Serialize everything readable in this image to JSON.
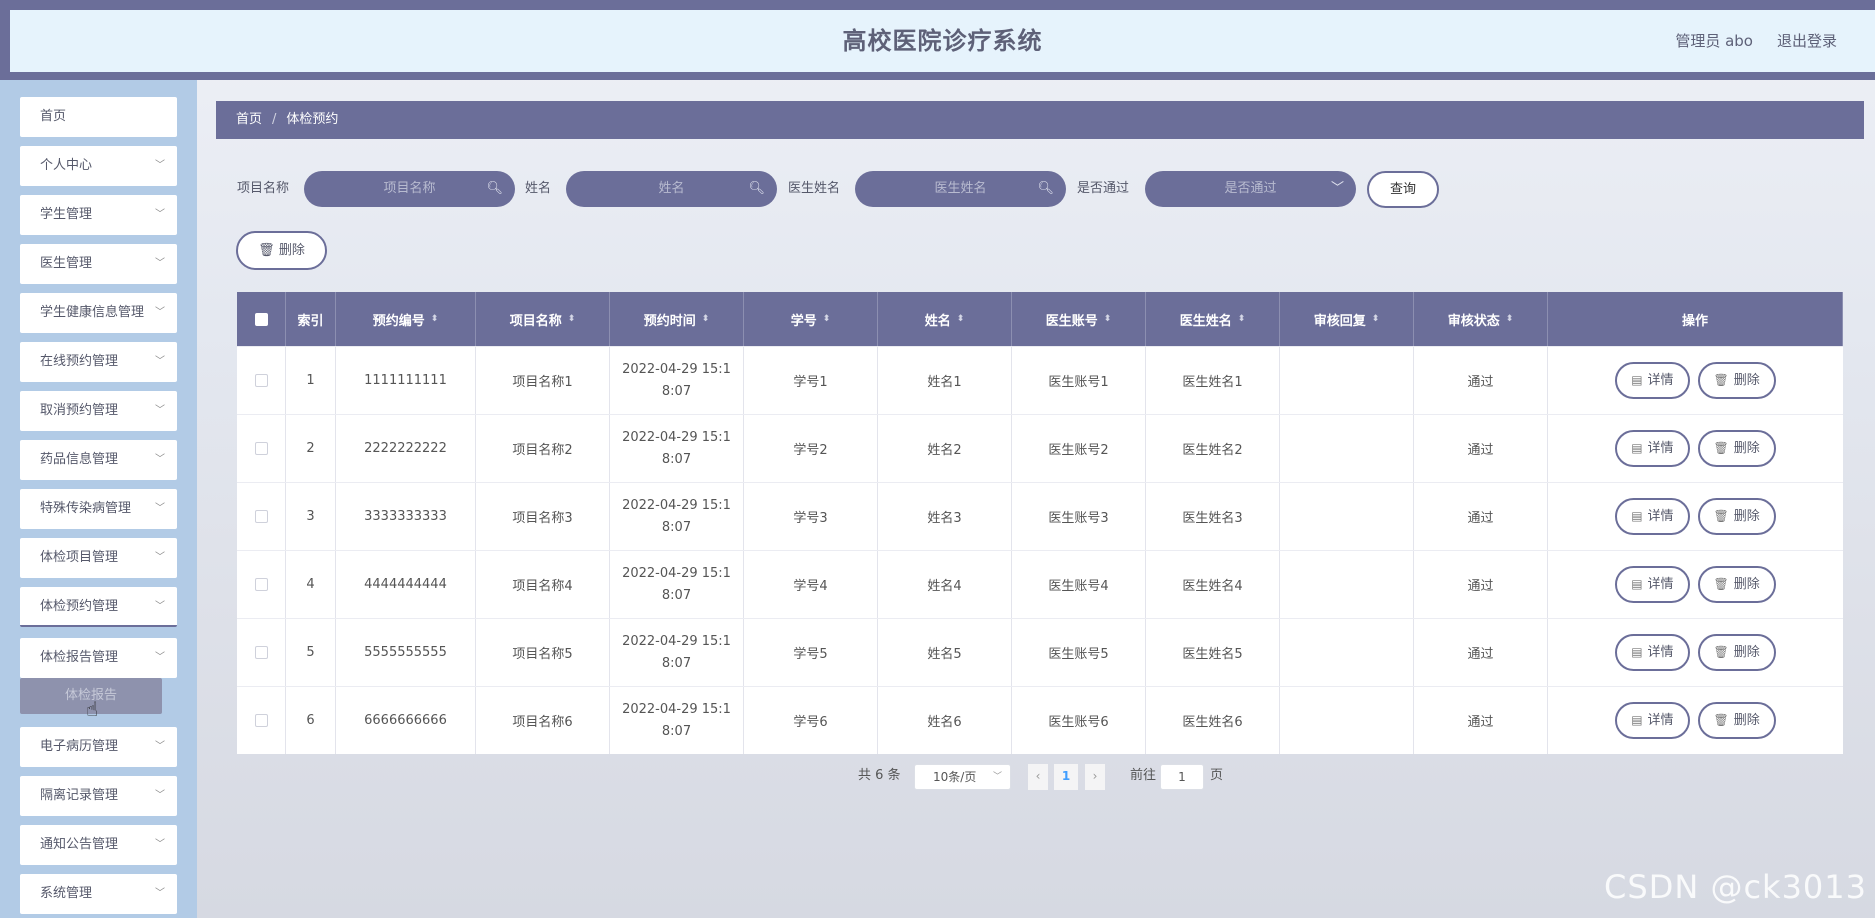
{
  "header": {
    "title": "高校医院诊疗系统",
    "admin": "管理员 abo",
    "logout": "退出登录"
  },
  "sidebar": {
    "items": [
      {
        "label": "首页",
        "chevron": false
      },
      {
        "label": "个人中心",
        "chevron": true
      },
      {
        "label": "学生管理",
        "chevron": true
      },
      {
        "label": "医生管理",
        "chevron": true
      },
      {
        "label": "学生健康信息管理",
        "chevron": true
      },
      {
        "label": "在线预约管理",
        "chevron": true
      },
      {
        "label": "取消预约管理",
        "chevron": true
      },
      {
        "label": "药品信息管理",
        "chevron": true
      },
      {
        "label": "特殊传染病管理",
        "chevron": true
      },
      {
        "label": "体检项目管理",
        "chevron": true
      },
      {
        "label": "体检预约管理",
        "chevron": true
      },
      {
        "label": "体检报告管理",
        "chevron": true
      },
      {
        "label": "电子病历管理",
        "chevron": true
      },
      {
        "label": "隔离记录管理",
        "chevron": true
      },
      {
        "label": "通知公告管理",
        "chevron": true
      },
      {
        "label": "系统管理",
        "chevron": true
      }
    ],
    "submenu": "体检报告"
  },
  "breadcrumb": {
    "home": "首页",
    "sep": "/",
    "current": "体检预约"
  },
  "search": {
    "project_label": "项目名称",
    "project_placeholder": "项目名称",
    "name_label": "姓名",
    "name_placeholder": "姓名",
    "doctor_label": "医生姓名",
    "doctor_placeholder": "医生姓名",
    "passed_label": "是否通过",
    "passed_placeholder": "是否通过",
    "query": "查询"
  },
  "batch_delete": "删除",
  "table": {
    "columns": [
      "索引",
      "预约编号",
      "项目名称",
      "预约时间",
      "学号",
      "姓名",
      "医生账号",
      "医生姓名",
      "审核回复",
      "审核状态",
      "操作"
    ],
    "rows": [
      {
        "index": "1",
        "no": "1111111111",
        "project": "项目名称1",
        "time1": "2022-04-29 15:1",
        "time2": "8:07",
        "sid": "学号1",
        "name": "姓名1",
        "doc_acc": "医生账号1",
        "doc_name": "医生姓名1",
        "reply": "",
        "status": "通过"
      },
      {
        "index": "2",
        "no": "2222222222",
        "project": "项目名称2",
        "time1": "2022-04-29 15:1",
        "time2": "8:07",
        "sid": "学号2",
        "name": "姓名2",
        "doc_acc": "医生账号2",
        "doc_name": "医生姓名2",
        "reply": "",
        "status": "通过"
      },
      {
        "index": "3",
        "no": "3333333333",
        "project": "项目名称3",
        "time1": "2022-04-29 15:1",
        "time2": "8:07",
        "sid": "学号3",
        "name": "姓名3",
        "doc_acc": "医生账号3",
        "doc_name": "医生姓名3",
        "reply": "",
        "status": "通过"
      },
      {
        "index": "4",
        "no": "4444444444",
        "project": "项目名称4",
        "time1": "2022-04-29 15:1",
        "time2": "8:07",
        "sid": "学号4",
        "name": "姓名4",
        "doc_acc": "医生账号4",
        "doc_name": "医生姓名4",
        "reply": "",
        "status": "通过"
      },
      {
        "index": "5",
        "no": "5555555555",
        "project": "项目名称5",
        "time1": "2022-04-29 15:1",
        "time2": "8:07",
        "sid": "学号5",
        "name": "姓名5",
        "doc_acc": "医生账号5",
        "doc_name": "医生姓名5",
        "reply": "",
        "status": "通过"
      },
      {
        "index": "6",
        "no": "6666666666",
        "project": "项目名称6",
        "time1": "2022-04-29 15:1",
        "time2": "8:07",
        "sid": "学号6",
        "name": "姓名6",
        "doc_acc": "医生账号6",
        "doc_name": "医生姓名6",
        "reply": "",
        "status": "通过"
      }
    ],
    "detail_label": "详情",
    "delete_label": "删除"
  },
  "pagination": {
    "total": "共 6 条",
    "page_size": "10条/页",
    "current": "1",
    "goto_label": "前往",
    "goto_value": "1",
    "page_label": "页"
  },
  "watermark": "CSDN @ck3013",
  "colors": {
    "accent": "#6b6e99",
    "sidebar": "#b2cbe6",
    "header_bg": "#e6f3fc"
  },
  "icons": {
    "search": "search-icon",
    "chevron": "chevron-down-icon",
    "trash": "trash-icon",
    "doc": "document-icon",
    "sort": "sort-icon"
  }
}
